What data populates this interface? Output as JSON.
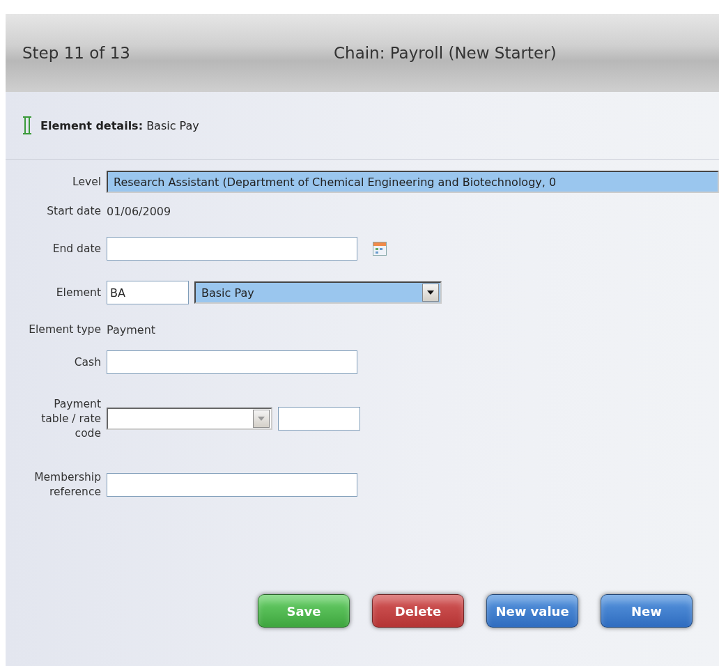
{
  "header": {
    "step": "Step 11 of 13",
    "chain": "Chain: Payroll (New Starter)"
  },
  "section": {
    "title": "Element details:",
    "value": "Basic Pay"
  },
  "fields": [
    {
      "kind": "select",
      "label": "Level",
      "value": "Research Assistant (Department of Chemical Engineering and Biotechnology, 0",
      "highlighted": true
    },
    {
      "kind": "text",
      "label": "Start date",
      "value": "01/06/2009"
    },
    {
      "kind": "date",
      "label": "End date"
    },
    {
      "kind": "code-select",
      "label": "Element",
      "code": "BA",
      "value": "Basic Pay",
      "highlighted": true,
      "disabled": false
    },
    {
      "kind": "text",
      "label": "Element type",
      "value": "Payment"
    },
    {
      "kind": "input",
      "label": "Cash"
    },
    {
      "kind": "code-select",
      "label": "Payment table / rate code",
      "disabled": true,
      "highlighted": false
    },
    {
      "kind": "input",
      "label": "Membership reference"
    }
  ],
  "buttons": [
    {
      "label": "Save",
      "kind": "save"
    },
    {
      "label": "Delete",
      "kind": "delete"
    },
    {
      "label": "New value",
      "kind": "primary"
    },
    {
      "label": "New",
      "kind": "primary"
    }
  ]
}
